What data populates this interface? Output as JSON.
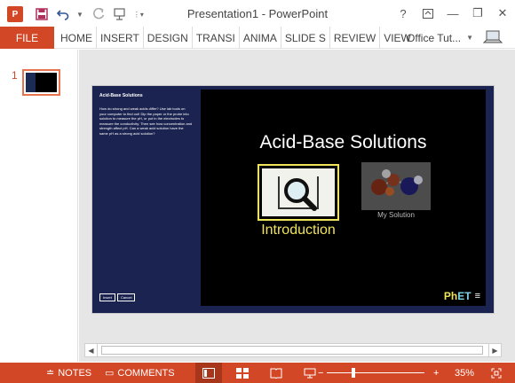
{
  "app": {
    "title": "Presentation1 - PowerPoint",
    "logo_letter": "P",
    "accent_color": "#d24726"
  },
  "quick_access": {
    "icons": [
      "save-icon",
      "undo-icon",
      "redo-icon",
      "start-from-beginning-icon",
      "customize-icon"
    ]
  },
  "window_controls": {
    "help": "?",
    "ribbon_options": "⧉",
    "minimize": "—",
    "restore": "❐",
    "close": "✕"
  },
  "ribbon": {
    "file_label": "FILE",
    "tabs": [
      "HOME",
      "INSERT",
      "DESIGN",
      "TRANSI",
      "ANIMA",
      "SLIDE S",
      "REVIEW",
      "VIEW"
    ],
    "account_label": "Office Tut..."
  },
  "thumbnails": {
    "slide_number": "1"
  },
  "slide": {
    "left_title": "Acid-Base Solutions",
    "left_description": "How do strong and weak acids differ? Use lab tools on your computer to find out! Dip the paper or the probe into solution to measure the pH, or put in the electrodes to measure the conductivity. Then see how concentration and strength affect pH. Can a weak acid solution have the same pH as a strong acid solution?",
    "insert_button": "Insert",
    "cancel_button": "Cancel",
    "sim_title": "Acid-Base Solutions",
    "intro_label": "Introduction",
    "my_solution_label": "My Solution",
    "phet_logo_ph": "PhET",
    "phet_menu": "≡"
  },
  "statusbar": {
    "notes_label": "NOTES",
    "comments_label": "COMMENTS",
    "zoom_level": "35%",
    "zoom_fraction": 0.35
  }
}
